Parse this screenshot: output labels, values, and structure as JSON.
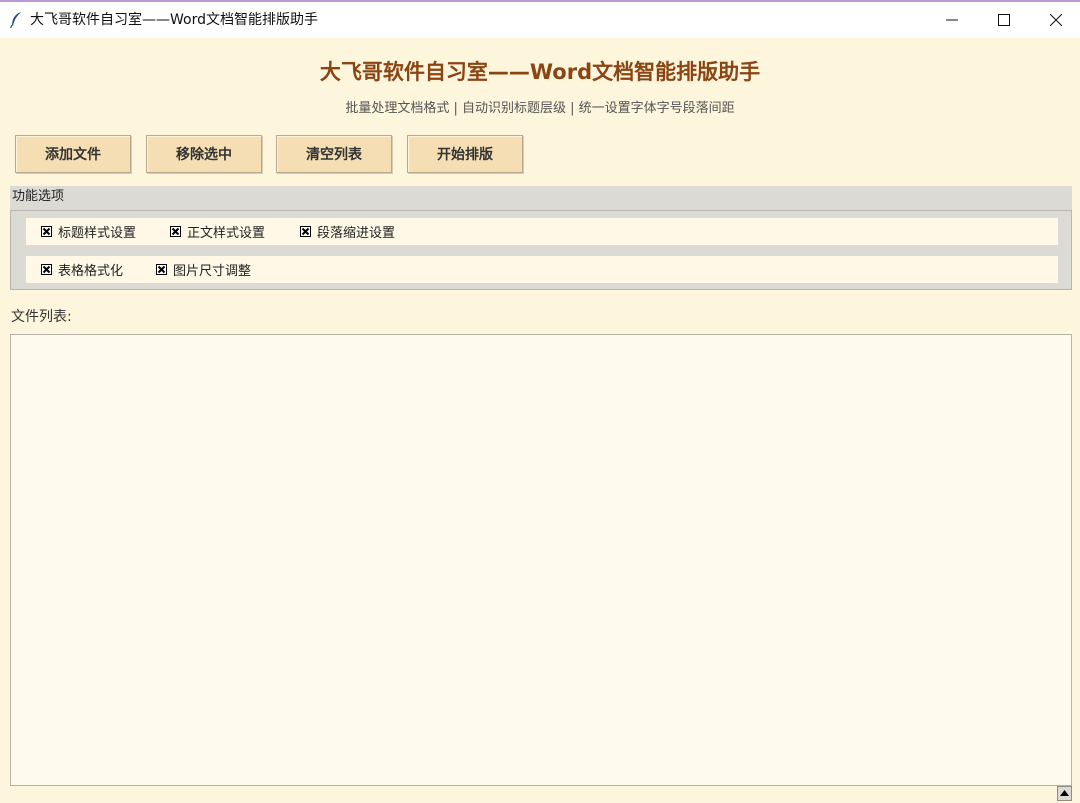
{
  "window": {
    "title": "大飞哥软件自习室——Word文档智能排版助手",
    "icon": "feather-icon",
    "controls": [
      "minimize-icon",
      "maximize-icon",
      "close-icon"
    ]
  },
  "header": {
    "title": "大飞哥软件自习室——Word文档智能排版助手",
    "subtitle": "批量处理文档格式 | 自动识别标题层级 | 统一设置字体字号段落间距"
  },
  "toolbar": {
    "add_label": "添加文件",
    "remove_label": "移除选中",
    "clear_label": "清空列表",
    "start_label": "开始排版"
  },
  "options": {
    "title": "功能选项",
    "row1": [
      {
        "label": "标题样式设置",
        "checked": true
      },
      {
        "label": "正文样式设置",
        "checked": true
      },
      {
        "label": "段落缩进设置",
        "checked": true
      }
    ],
    "row2": [
      {
        "label": "表格格式化",
        "checked": true
      },
      {
        "label": "图片尺寸调整",
        "checked": true
      }
    ]
  },
  "file_list": {
    "label": "文件列表:",
    "items": []
  },
  "colors": {
    "background": "#fdf5dc",
    "button": "#f5deb3",
    "title_brown": "#8b4513",
    "panel_gray": "#dcdad5"
  }
}
